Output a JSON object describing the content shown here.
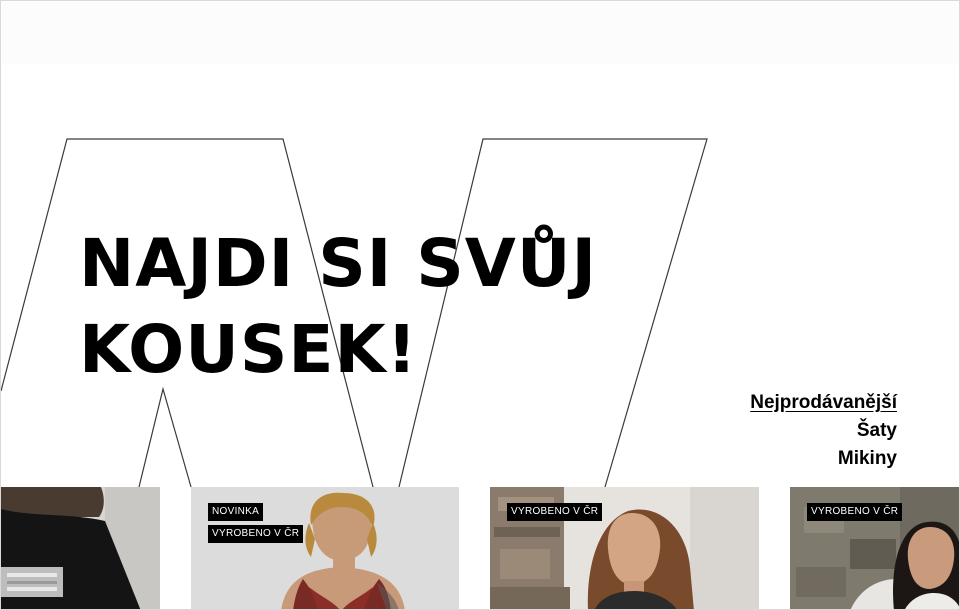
{
  "hero": {
    "title_line1": "NAJDI SI SVŮJ",
    "title_line2": "KOUSEK!"
  },
  "categories": [
    {
      "label": "Nejprodávanější",
      "active": true
    },
    {
      "label": "Šaty",
      "active": false
    },
    {
      "label": "Mikiny",
      "active": false
    }
  ],
  "products": [
    {
      "badges": []
    },
    {
      "badges": [
        "NOVINKA",
        "VYROBENO V ČR"
      ]
    },
    {
      "badges": [
        "VYROBENO V ČR"
      ]
    },
    {
      "badges": [
        "VYROBENO V ČR"
      ]
    }
  ],
  "colors": {
    "background": "#ffffff",
    "text": "#000000",
    "badge_bg": "#000000",
    "badge_text": "#ffffff",
    "outline": "#3a3a3a"
  }
}
